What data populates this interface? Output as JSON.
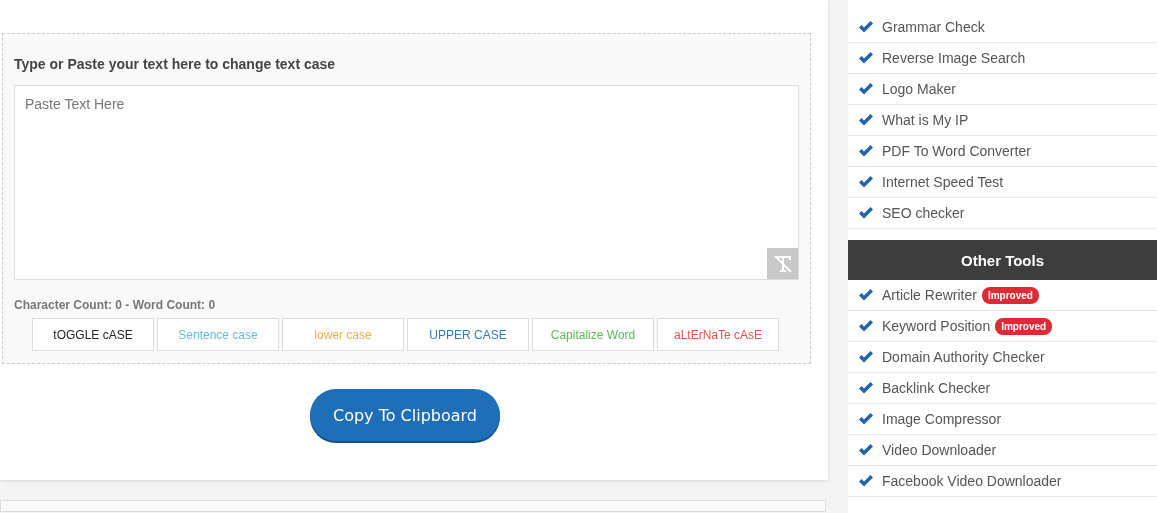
{
  "tool": {
    "heading": "Type or Paste your text here to change text case",
    "textarea": {
      "placeholder": "Paste Text Here"
    },
    "counts": "Character Count: 0 - Word Count: 0",
    "case_buttons": [
      {
        "label": "tOGGLE cASE",
        "color": "#222222"
      },
      {
        "label": "Sentence case",
        "color": "#5bc0de"
      },
      {
        "label": "lower case",
        "color": "#f0ad4e"
      },
      {
        "label": "UPPER CASE",
        "color": "#337ab7"
      },
      {
        "label": "Capitalize Word",
        "color": "#5cb85c"
      },
      {
        "label": "aLtErNaTe cAsE",
        "color": "#d9534f"
      }
    ],
    "copy_button": "Copy To Clipboard"
  },
  "sidebar": {
    "top_list": [
      {
        "label": "Grammar Check",
        "badge": false
      },
      {
        "label": "Reverse Image Search",
        "badge": false
      },
      {
        "label": "Logo Maker",
        "badge": false
      },
      {
        "label": "What is My IP",
        "badge": false
      },
      {
        "label": "PDF To Word Converter",
        "badge": false
      },
      {
        "label": "Internet Speed Test",
        "badge": false
      },
      {
        "label": "SEO checker",
        "badge": false
      }
    ],
    "other_tools": {
      "title": "Other Tools",
      "items": [
        {
          "label": "Article Rewriter",
          "badge": true,
          "badge_label": "Improved"
        },
        {
          "label": "Keyword Position",
          "badge": true,
          "badge_label": "Improved"
        },
        {
          "label": "Domain Authority Checker",
          "badge": false
        },
        {
          "label": "Backlink Checker",
          "badge": false
        },
        {
          "label": "Image Compressor",
          "badge": false
        },
        {
          "label": "Video Downloader",
          "badge": false
        },
        {
          "label": "Facebook Video Downloader",
          "badge": false
        }
      ]
    }
  }
}
